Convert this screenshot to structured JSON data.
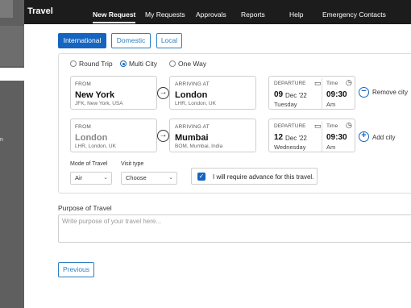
{
  "sidebar": {
    "fragment_text": "n"
  },
  "nav": {
    "brand": "Travel",
    "items": [
      "New Request",
      "My Requests",
      "Approvals",
      "Reports",
      "Help",
      "Emergency Contacts"
    ],
    "active": "New Request"
  },
  "trip_scope": {
    "options": [
      "International",
      "Domestic",
      "Local"
    ],
    "selected": "International"
  },
  "trip_type": {
    "options": [
      "Round Trip",
      "Multi City",
      "One Way"
    ],
    "selected": "Multi City"
  },
  "legs": [
    {
      "from_label": "FROM",
      "from_city": "New York",
      "from_sub": "JFK, New York, USA",
      "to_label": "ARRIVING AT",
      "to_city": "London",
      "to_sub": "LHR, London, UK",
      "departure_label": "DEPARTURE",
      "day": "09",
      "month": "Dec '22",
      "weekday": "Tuesday",
      "time_label": "Time",
      "time": "09:30",
      "ampm": "Am",
      "action_label": "Remove city"
    },
    {
      "from_label": "FROM",
      "from_city": "London",
      "from_sub": "LHR, London, UK",
      "to_label": "ARRIVING AT",
      "to_city": "Mumbai",
      "to_sub": "BOM, Mumbai, India",
      "departure_label": "DEPARTURE",
      "day": "12",
      "month": "Dec '22",
      "weekday": "Wednesday",
      "time_label": "Time",
      "time": "09:30",
      "ampm": "Am",
      "action_label": "Add city"
    }
  ],
  "mode_of_travel": {
    "label": "Mode of Travel",
    "value": "Air"
  },
  "visit_type": {
    "label": "Visit type",
    "value": "Choose"
  },
  "advance": {
    "label": "I will require advance for this travel.",
    "checked": true
  },
  "purpose": {
    "label": "Purpose of Travel",
    "placeholder": "Write purpose of your travel here..."
  },
  "previous_button": "Previous",
  "colors": {
    "accent": "#1565c0",
    "nav_bg": "#1c1c1c",
    "sidebar_bg": "#5f5f5f"
  }
}
